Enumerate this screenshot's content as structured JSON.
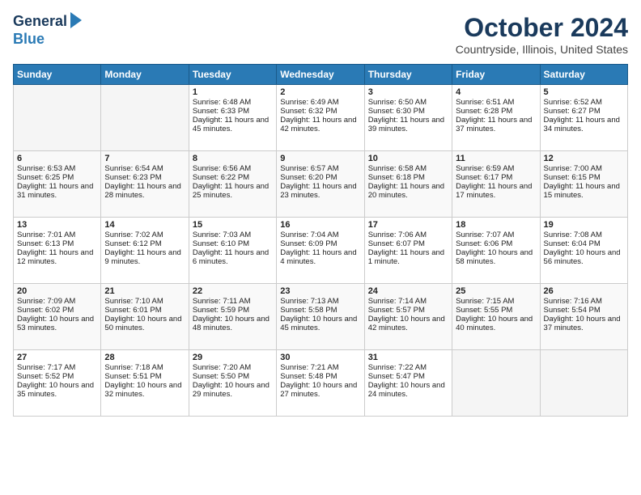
{
  "header": {
    "logo_line1": "General",
    "logo_line2": "Blue",
    "month": "October 2024",
    "location": "Countryside, Illinois, United States"
  },
  "days_of_week": [
    "Sunday",
    "Monday",
    "Tuesday",
    "Wednesday",
    "Thursday",
    "Friday",
    "Saturday"
  ],
  "weeks": [
    [
      {
        "day": "",
        "empty": true
      },
      {
        "day": "",
        "empty": true
      },
      {
        "day": "1",
        "sunrise": "6:48 AM",
        "sunset": "6:33 PM",
        "daylight": "11 hours and 45 minutes."
      },
      {
        "day": "2",
        "sunrise": "6:49 AM",
        "sunset": "6:32 PM",
        "daylight": "11 hours and 42 minutes."
      },
      {
        "day": "3",
        "sunrise": "6:50 AM",
        "sunset": "6:30 PM",
        "daylight": "11 hours and 39 minutes."
      },
      {
        "day": "4",
        "sunrise": "6:51 AM",
        "sunset": "6:28 PM",
        "daylight": "11 hours and 37 minutes."
      },
      {
        "day": "5",
        "sunrise": "6:52 AM",
        "sunset": "6:27 PM",
        "daylight": "11 hours and 34 minutes."
      }
    ],
    [
      {
        "day": "6",
        "sunrise": "6:53 AM",
        "sunset": "6:25 PM",
        "daylight": "11 hours and 31 minutes."
      },
      {
        "day": "7",
        "sunrise": "6:54 AM",
        "sunset": "6:23 PM",
        "daylight": "11 hours and 28 minutes."
      },
      {
        "day": "8",
        "sunrise": "6:56 AM",
        "sunset": "6:22 PM",
        "daylight": "11 hours and 25 minutes."
      },
      {
        "day": "9",
        "sunrise": "6:57 AM",
        "sunset": "6:20 PM",
        "daylight": "11 hours and 23 minutes."
      },
      {
        "day": "10",
        "sunrise": "6:58 AM",
        "sunset": "6:18 PM",
        "daylight": "11 hours and 20 minutes."
      },
      {
        "day": "11",
        "sunrise": "6:59 AM",
        "sunset": "6:17 PM",
        "daylight": "11 hours and 17 minutes."
      },
      {
        "day": "12",
        "sunrise": "7:00 AM",
        "sunset": "6:15 PM",
        "daylight": "11 hours and 15 minutes."
      }
    ],
    [
      {
        "day": "13",
        "sunrise": "7:01 AM",
        "sunset": "6:13 PM",
        "daylight": "11 hours and 12 minutes."
      },
      {
        "day": "14",
        "sunrise": "7:02 AM",
        "sunset": "6:12 PM",
        "daylight": "11 hours and 9 minutes."
      },
      {
        "day": "15",
        "sunrise": "7:03 AM",
        "sunset": "6:10 PM",
        "daylight": "11 hours and 6 minutes."
      },
      {
        "day": "16",
        "sunrise": "7:04 AM",
        "sunset": "6:09 PM",
        "daylight": "11 hours and 4 minutes."
      },
      {
        "day": "17",
        "sunrise": "7:06 AM",
        "sunset": "6:07 PM",
        "daylight": "11 hours and 1 minute."
      },
      {
        "day": "18",
        "sunrise": "7:07 AM",
        "sunset": "6:06 PM",
        "daylight": "10 hours and 58 minutes."
      },
      {
        "day": "19",
        "sunrise": "7:08 AM",
        "sunset": "6:04 PM",
        "daylight": "10 hours and 56 minutes."
      }
    ],
    [
      {
        "day": "20",
        "sunrise": "7:09 AM",
        "sunset": "6:02 PM",
        "daylight": "10 hours and 53 minutes."
      },
      {
        "day": "21",
        "sunrise": "7:10 AM",
        "sunset": "6:01 PM",
        "daylight": "10 hours and 50 minutes."
      },
      {
        "day": "22",
        "sunrise": "7:11 AM",
        "sunset": "5:59 PM",
        "daylight": "10 hours and 48 minutes."
      },
      {
        "day": "23",
        "sunrise": "7:13 AM",
        "sunset": "5:58 PM",
        "daylight": "10 hours and 45 minutes."
      },
      {
        "day": "24",
        "sunrise": "7:14 AM",
        "sunset": "5:57 PM",
        "daylight": "10 hours and 42 minutes."
      },
      {
        "day": "25",
        "sunrise": "7:15 AM",
        "sunset": "5:55 PM",
        "daylight": "10 hours and 40 minutes."
      },
      {
        "day": "26",
        "sunrise": "7:16 AM",
        "sunset": "5:54 PM",
        "daylight": "10 hours and 37 minutes."
      }
    ],
    [
      {
        "day": "27",
        "sunrise": "7:17 AM",
        "sunset": "5:52 PM",
        "daylight": "10 hours and 35 minutes."
      },
      {
        "day": "28",
        "sunrise": "7:18 AM",
        "sunset": "5:51 PM",
        "daylight": "10 hours and 32 minutes."
      },
      {
        "day": "29",
        "sunrise": "7:20 AM",
        "sunset": "5:50 PM",
        "daylight": "10 hours and 29 minutes."
      },
      {
        "day": "30",
        "sunrise": "7:21 AM",
        "sunset": "5:48 PM",
        "daylight": "10 hours and 27 minutes."
      },
      {
        "day": "31",
        "sunrise": "7:22 AM",
        "sunset": "5:47 PM",
        "daylight": "10 hours and 24 minutes."
      },
      {
        "day": "",
        "empty": true
      },
      {
        "day": "",
        "empty": true
      }
    ]
  ]
}
